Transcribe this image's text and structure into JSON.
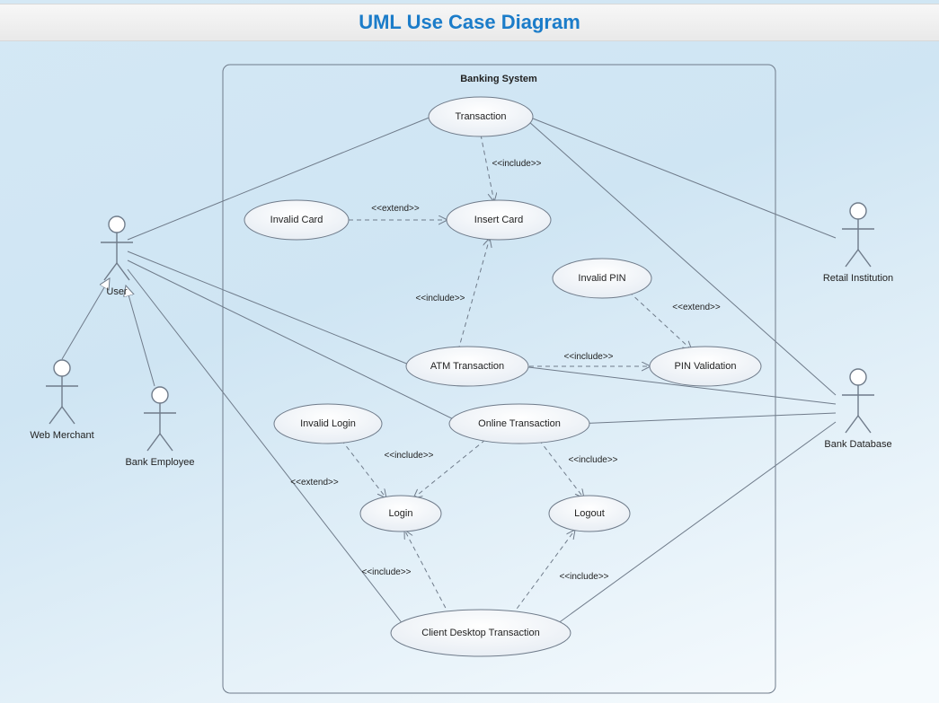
{
  "title": "UML Use Case Diagram",
  "system_name": "Banking System",
  "actors": {
    "user": "User",
    "web_merchant": "Web Merchant",
    "bank_employee": "Bank Employee",
    "retail_institution": "Retail Institution",
    "bank_database": "Bank Database"
  },
  "usecases": {
    "transaction": "Transaction",
    "invalid_card": "Invalid Card",
    "insert_card": "Insert Card",
    "invalid_pin": "Invalid PIN",
    "atm_transaction": "ATM Transaction",
    "pin_validation": "PIN Validation",
    "invalid_login": "Invalid Login",
    "online_transaction": "Online Transaction",
    "login": "Login",
    "logout": "Logout",
    "client_desktop_transaction": "Client Desktop Transaction"
  },
  "stereotypes": {
    "include": "<<include>>",
    "extend": "<<extend>>"
  }
}
